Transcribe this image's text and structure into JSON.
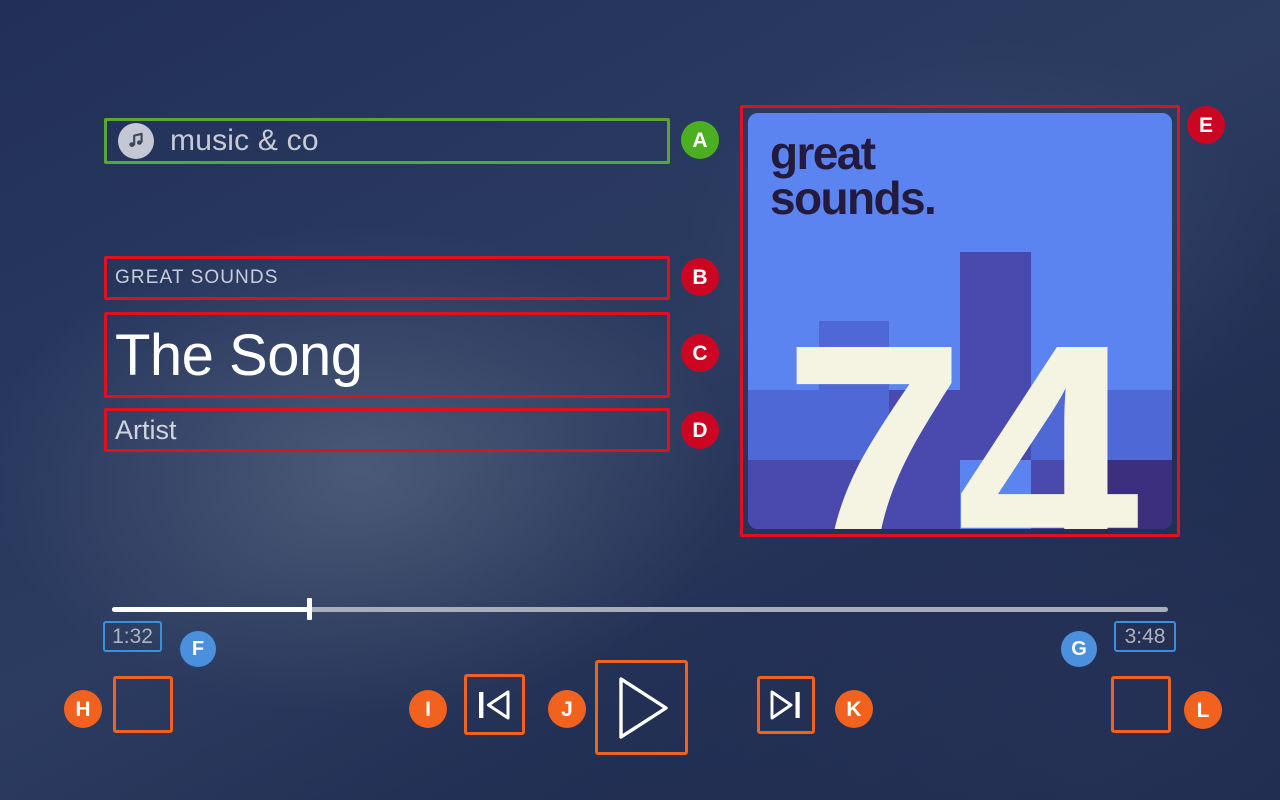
{
  "app": {
    "title": "music & co",
    "logo_icon": "music-note-icon"
  },
  "now_playing": {
    "album": "GREAT SOUNDS",
    "title": "The Song",
    "artist": "Artist"
  },
  "album_art": {
    "wordmark_line1": "great",
    "wordmark_line2": "sounds.",
    "number": "74",
    "palette": {
      "base_blue": "#5b84f0",
      "mid_blue": "#4e68d6",
      "indigo": "#4a49ad",
      "deep_purple": "#3c2f7e",
      "cream": "#f5f4e3",
      "ink": "#241a3d"
    }
  },
  "player": {
    "elapsed": "1:32",
    "total": "3:48",
    "progress_percent": 18.7
  },
  "controls": {
    "extra_left": "",
    "previous": "previous-track-icon",
    "play": "play-icon",
    "next": "next-track-icon",
    "extra_right": ""
  },
  "annotations": {
    "colors": {
      "green": "#4caf22",
      "red": "#cc0622",
      "blue": "#4a90dd",
      "orange": "#f2621f"
    },
    "markers": [
      {
        "id": "A",
        "label": "A",
        "color": "green",
        "target": "app-title"
      },
      {
        "id": "B",
        "label": "B",
        "color": "red",
        "target": "album-name"
      },
      {
        "id": "C",
        "label": "C",
        "color": "red",
        "target": "track-title"
      },
      {
        "id": "D",
        "label": "D",
        "color": "red",
        "target": "artist-name"
      },
      {
        "id": "E",
        "label": "E",
        "color": "red",
        "target": "album-art"
      },
      {
        "id": "F",
        "label": "F",
        "color": "blue",
        "target": "time-elapsed"
      },
      {
        "id": "G",
        "label": "G",
        "color": "blue",
        "target": "time-total"
      },
      {
        "id": "H",
        "label": "H",
        "color": "orange",
        "target": "extra-left-button"
      },
      {
        "id": "I",
        "label": "I",
        "color": "orange",
        "target": "previous-button"
      },
      {
        "id": "J",
        "label": "J",
        "color": "orange",
        "target": "play-button"
      },
      {
        "id": "K",
        "label": "K",
        "color": "orange",
        "target": "next-button"
      },
      {
        "id": "L",
        "label": "L",
        "color": "orange",
        "target": "extra-right-button"
      }
    ]
  }
}
